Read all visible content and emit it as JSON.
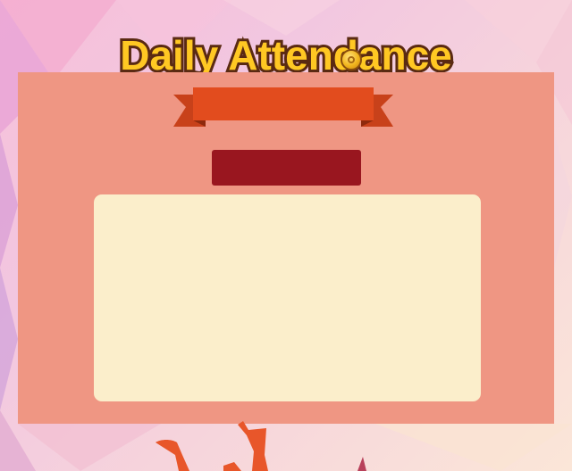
{
  "header": {
    "title": "Daily Attendance"
  },
  "panel": {
    "ribbon_label": "",
    "date_badge_label": ""
  },
  "colors": {
    "panel": "#ef9683",
    "ribbon": "#e24c1e",
    "badge": "#99161f",
    "calendar_bg": "#fbeecb",
    "title_fill": "#ffc823",
    "title_outline": "#5a2a12"
  },
  "icons": {
    "coin": "coin-icon"
  }
}
